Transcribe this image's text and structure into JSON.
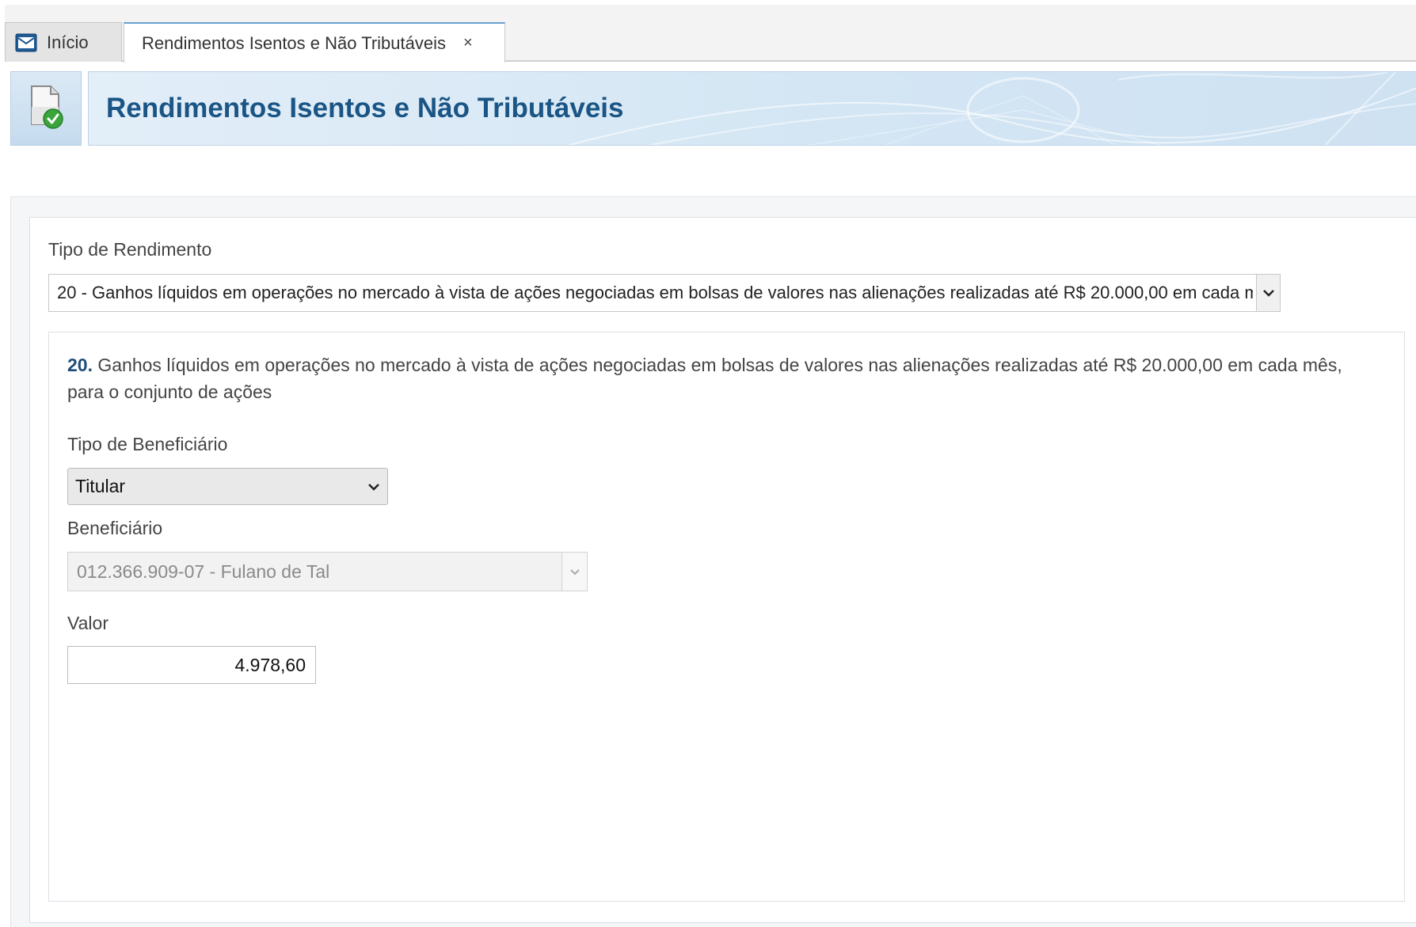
{
  "tabs": {
    "home_label": "Início",
    "active_label": "Rendimentos Isentos e Não Tributáveis",
    "close_symbol": "×"
  },
  "header": {
    "title": "Rendimentos Isentos e Não Tributáveis",
    "icon": "document-check-icon"
  },
  "form": {
    "tipo_rendimento_label": "Tipo de Rendimento",
    "tipo_rendimento_value": "20 - Ganhos líquidos em operações no mercado à vista de ações negociadas em bolsas de valores nas alienações realizadas até R$ 20.000,00 em cada mês, para o conjunto de ações",
    "description_number": "20.",
    "description_text": " Ganhos líquidos em operações no mercado à vista de ações negociadas em bolsas de valores nas alienações realizadas até R$ 20.000,00 em cada mês, para o conjunto de ações",
    "tipo_beneficiario_label": "Tipo de Beneficiário",
    "tipo_beneficiario_value": "Titular",
    "beneficiario_label": "Beneficiário",
    "beneficiario_value": "012.366.909-07 - Fulano de Tal",
    "valor_label": "Valor",
    "valor_value": "4.978,60"
  },
  "colors": {
    "title_blue": "#1a5585",
    "accent_green": "#3aa53a",
    "tab_border_blue": "#6aa0cf"
  }
}
